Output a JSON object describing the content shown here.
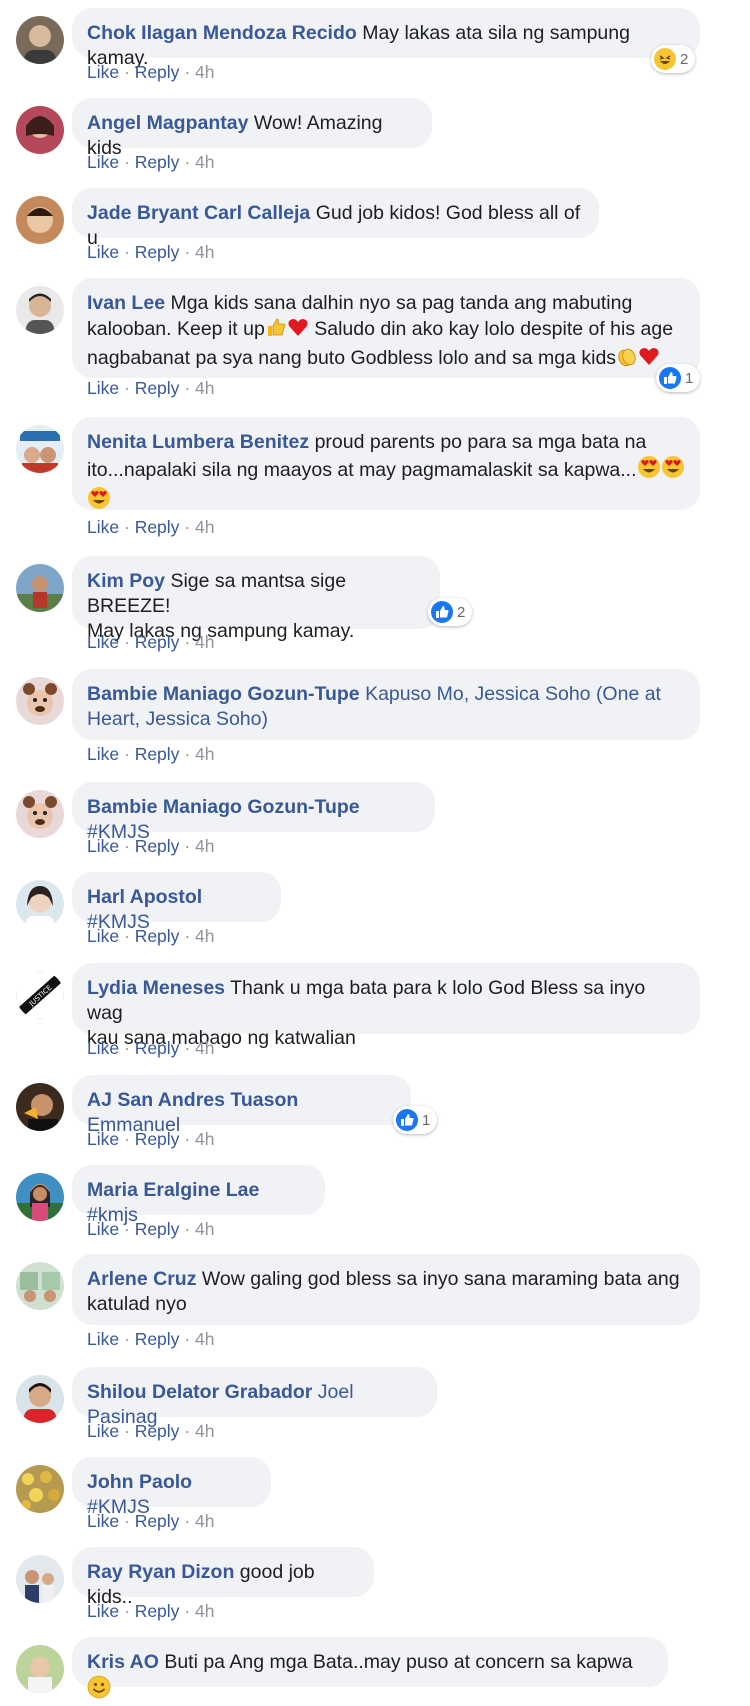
{
  "actions": {
    "like": "Like",
    "reply": "Reply",
    "sep": "·"
  },
  "comments": [
    {
      "id": "c1",
      "name": "Chok Ilagan Mendoza Recido",
      "text": "May lakas ata sila ng sampung kamay.",
      "time": "4h",
      "reaction": {
        "type": "haha",
        "count": "2"
      }
    },
    {
      "id": "c2",
      "name": "Angel Magpantay",
      "text": "Wow! Amazing kids",
      "time": "4h"
    },
    {
      "id": "c3",
      "name": "Jade Bryant Carl Calleja",
      "text": "Gud job kidos! God bless all of u",
      "time": "4h"
    },
    {
      "id": "c4",
      "name": "Ivan Lee",
      "text_line1": "Mga kids sana dalhin nyo sa pag tanda ang mabuting",
      "text_line2": "kalooban. Keep it up",
      "text_line2b": " Saludo din ako kay lolo despite of his age",
      "text_line3": "nagbabanat pa sya nang buto Godbless lolo and sa mga kids",
      "time": "4h",
      "reaction": {
        "type": "like",
        "count": "1"
      },
      "emoji": [
        "thumbs-up",
        "red-heart",
        "clapping-hands",
        "red-heart"
      ]
    },
    {
      "id": "c5",
      "name": "Nenita Lumbera Benitez",
      "text_line1": "proud parents po para sa mga bata na",
      "text_line2": "ito...napalaki sila ng maayos at may pagmamalaskit sa kapwa...",
      "time": "4h",
      "emoji": [
        "heart-eyes",
        "heart-eyes",
        "heart-eyes"
      ]
    },
    {
      "id": "c6",
      "name": "Kim Poy",
      "text_line1": "Sige sa mantsa sige BREEZE!",
      "text_line2": "May lakas ng sampung kamay.",
      "time": "4h",
      "reaction": {
        "type": "like",
        "count": "2"
      }
    },
    {
      "id": "c7",
      "name": "Bambie Maniago Gozun-Tupe",
      "tag_line1": "Kapuso Mo, Jessica Soho (One at",
      "tag_line2": "Heart, Jessica Soho)",
      "time": "4h"
    },
    {
      "id": "c8",
      "name": "Bambie Maniago Gozun-Tupe",
      "tag": "#KMJS",
      "time": "4h"
    },
    {
      "id": "c9",
      "name": "Harl Apostol",
      "tag": "#KMJS",
      "time": "4h"
    },
    {
      "id": "c10",
      "name": "Lydia Meneses",
      "text_line1": "Thank u mga bata para k lolo God Bless sa inyo wag",
      "text_line2": "kau sana mabago ng katwalian",
      "time": "4h"
    },
    {
      "id": "c11",
      "name": "AJ San Andres Tuason",
      "tag": "Emmanuel",
      "time": "4h",
      "reaction": {
        "type": "like",
        "count": "1"
      }
    },
    {
      "id": "c12",
      "name": "Maria Eralgine Lae",
      "tag": "#kmjs",
      "time": "4h"
    },
    {
      "id": "c13",
      "name": "Arlene Cruz",
      "text_line1": "Wow galing god bless sa inyo sana maraming bata ang",
      "text_line2": "katulad nyo",
      "time": "4h"
    },
    {
      "id": "c14",
      "name": "Shilou Delator Grabador",
      "tag": "Joel Pasinag",
      "time": "4h"
    },
    {
      "id": "c15",
      "name": "John Paolo",
      "tag": "#KMJS",
      "time": "4h"
    },
    {
      "id": "c16",
      "name": "Ray Ryan Dizon",
      "text": "good job kids..",
      "time": "4h"
    },
    {
      "id": "c17",
      "name": "Kris AO",
      "text": "Buti pa Ang mga Bata..may puso at concern sa kapwa",
      "emoji": [
        "smiling-face"
      ]
    }
  ],
  "colors": {
    "name": "#385898",
    "bubble": "#f0f2f5",
    "text": "#1c1e21",
    "meta": "#90949c",
    "like": "#1877f2"
  }
}
